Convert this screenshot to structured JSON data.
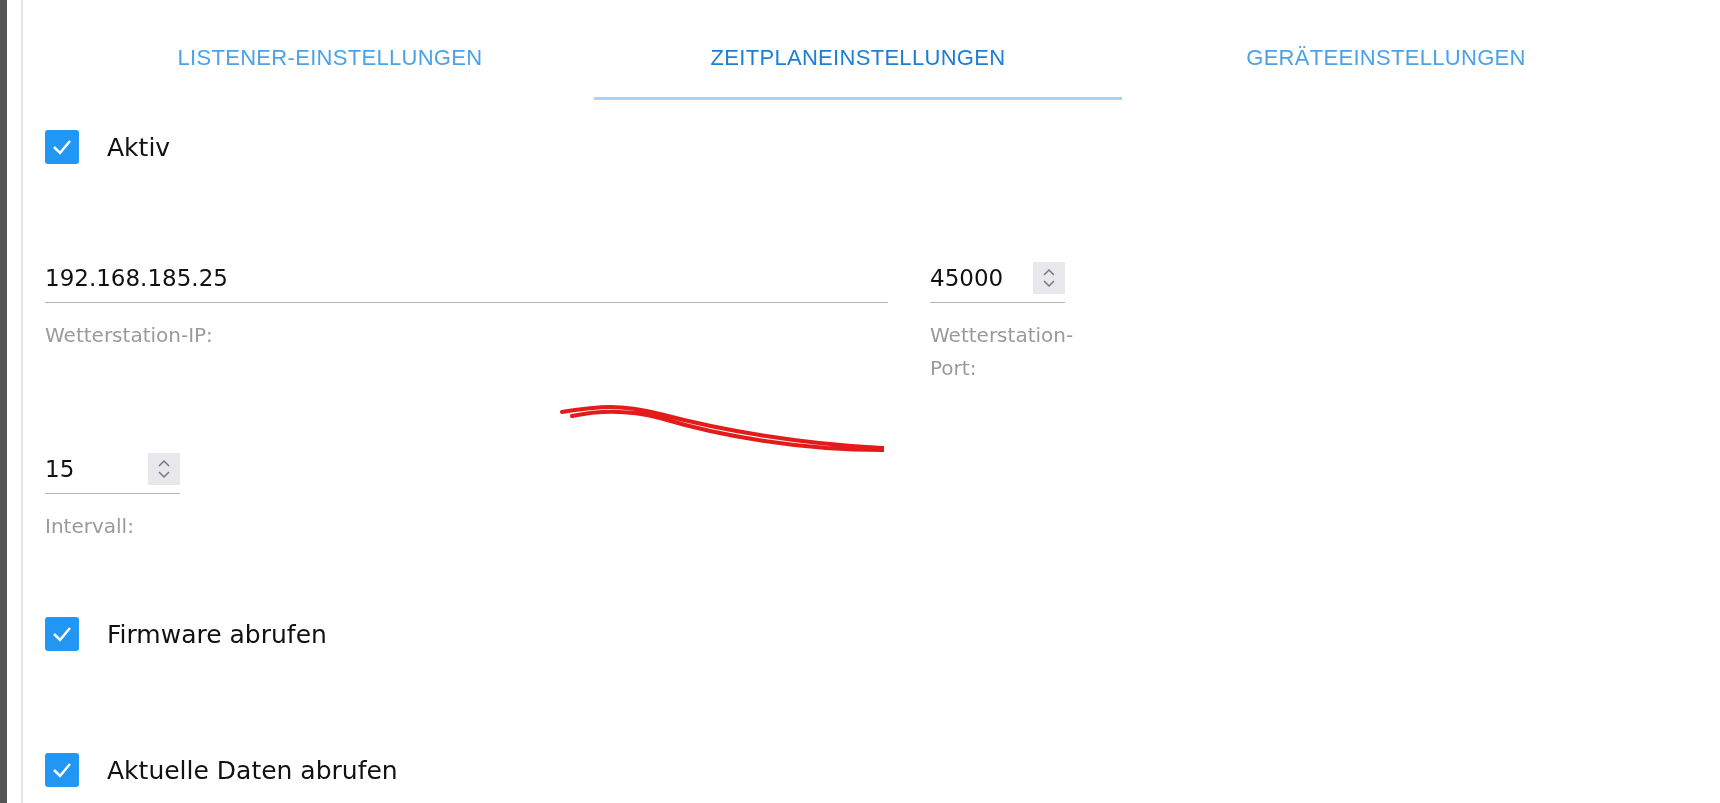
{
  "tabs": [
    {
      "label": "LISTENER-EINSTELLUNGEN",
      "selected": false
    },
    {
      "label": "ZEITPLANEINSTELLUNGEN",
      "selected": true
    },
    {
      "label": "GERÄTEEINSTELLUNGEN",
      "selected": false
    }
  ],
  "active": {
    "label": "Aktiv",
    "checked": true
  },
  "station_ip": {
    "value": "192.168.185.25",
    "label": "Wetterstation-IP:"
  },
  "station_port": {
    "value": "45000",
    "label": "Wetterstation-Port:"
  },
  "interval": {
    "value": "15",
    "label": "Intervall:"
  },
  "options": [
    {
      "label": "Firmware abrufen",
      "checked": true
    },
    {
      "label": "Aktuelle Daten abrufen",
      "checked": true
    }
  ]
}
